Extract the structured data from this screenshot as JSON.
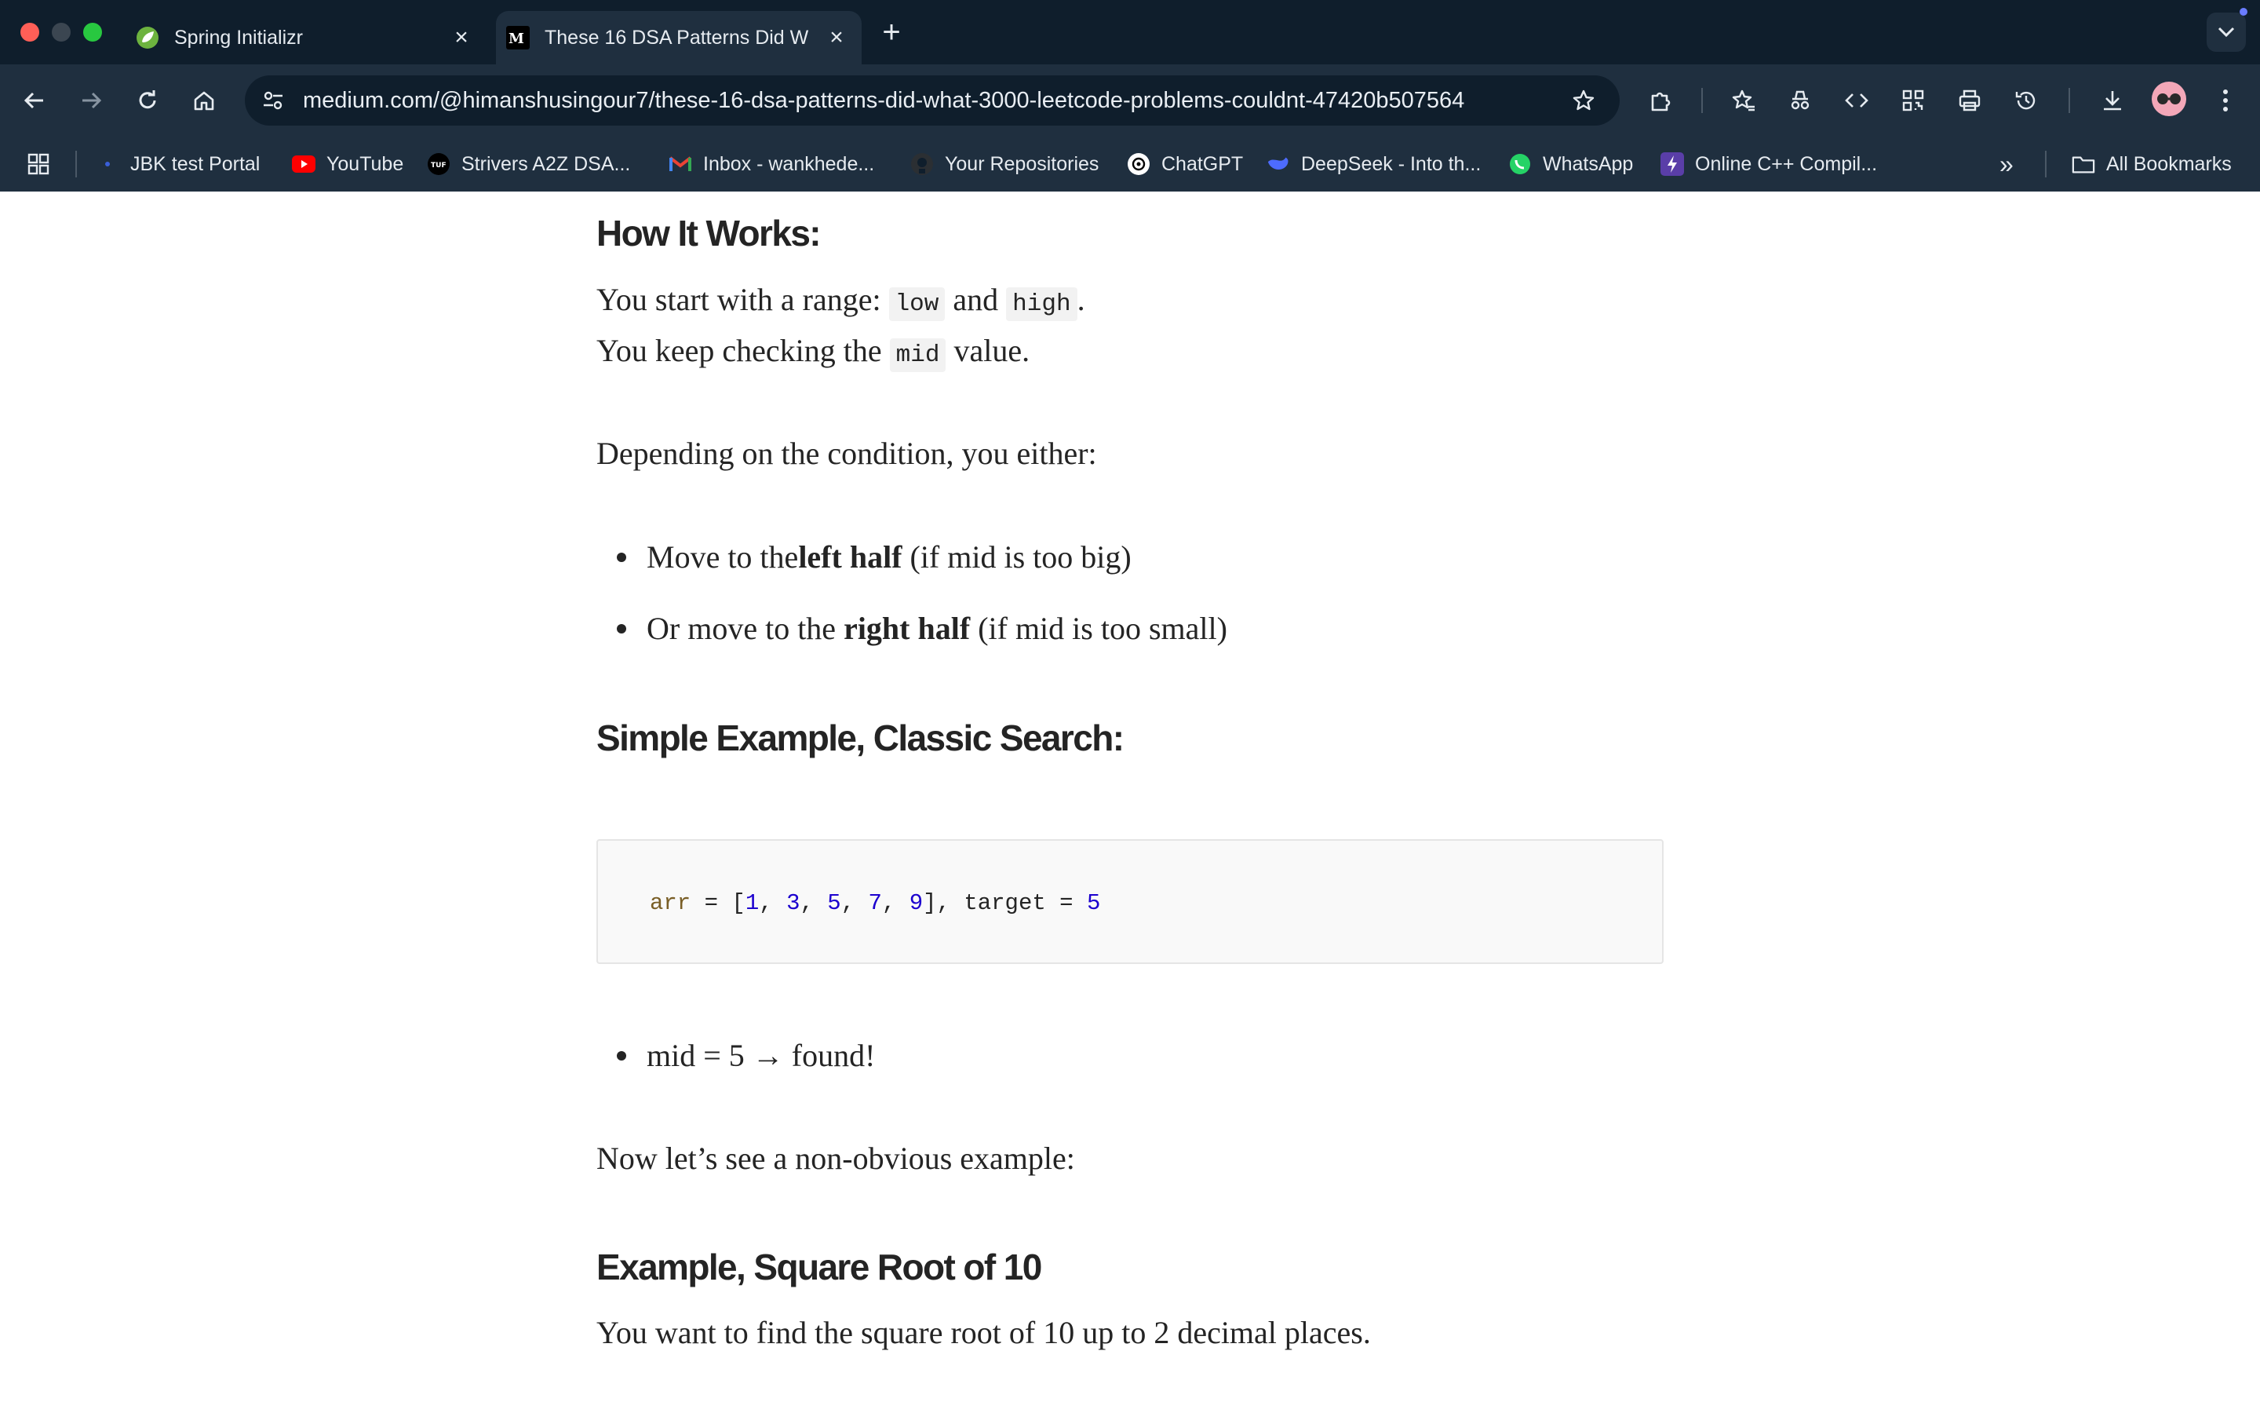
{
  "browser": {
    "tabs": [
      {
        "title": "Spring Initializr",
        "icon": "spring-leaf-icon",
        "active": false
      },
      {
        "title": "These 16 DSA Patterns Did W",
        "icon": "medium-logo-icon",
        "active": true
      }
    ],
    "new_tab_label": "+",
    "url": "medium.com/@himanshusingour7/these-16-dsa-patterns-did-what-3000-leetcode-problems-couldnt-47420b507564",
    "bookmarks": [
      {
        "label": "JBK test Portal",
        "icon": "jbk-icon"
      },
      {
        "label": "YouTube",
        "icon": "youtube-icon"
      },
      {
        "label": "Strivers A2Z DSA...",
        "icon": "tuf-icon"
      },
      {
        "label": "Inbox - wankhede...",
        "icon": "gmail-icon"
      },
      {
        "label": "Your Repositories",
        "icon": "github-icon"
      },
      {
        "label": "ChatGPT",
        "icon": "chatgpt-icon"
      },
      {
        "label": "DeepSeek - Into th...",
        "icon": "deepseek-icon"
      },
      {
        "label": "WhatsApp",
        "icon": "whatsapp-icon"
      },
      {
        "label": "Online C++ Compil...",
        "icon": "compiler-icon"
      }
    ],
    "all_bookmarks_label": "All Bookmarks",
    "overflow_label": "»"
  },
  "article": {
    "heading1": "How It Works:",
    "line1": {
      "prefix": "You start with a range: ",
      "code_low": "low",
      "mid_text": " and ",
      "code_high": "high",
      "suffix": "."
    },
    "line2": {
      "prefix": "You keep checking the ",
      "code_mid": "mid",
      "suffix": " value."
    },
    "condition": "Depending on the condition, you either:",
    "bullets": [
      {
        "prefix": "Move to the ",
        "bold": "left half",
        "suffix": " (if mid is too big)"
      },
      {
        "prefix": "Or move to the ",
        "bold": "right half",
        "suffix": " (if mid is too small)"
      }
    ],
    "heading2": "Simple Example, Classic Search:",
    "code": {
      "var": "arr",
      "eq": " = [",
      "nums": [
        "1",
        "3",
        "5",
        "7",
        "9"
      ],
      "tail": "], target = ",
      "target": "5"
    },
    "found": "mid = 5 → found!",
    "nonobvious": "Now let’s see a non-obvious example:",
    "heading3": "Example, Square Root of 10",
    "sqrt_intro": "You want to find the square root of 10 up to 2 decimal places."
  },
  "colors": {
    "tabstrip": "#0f1e2c",
    "toolbar": "#1f2f3f",
    "text": "#242424",
    "code_number": "#1c00cf",
    "code_variable": "#795e26"
  }
}
